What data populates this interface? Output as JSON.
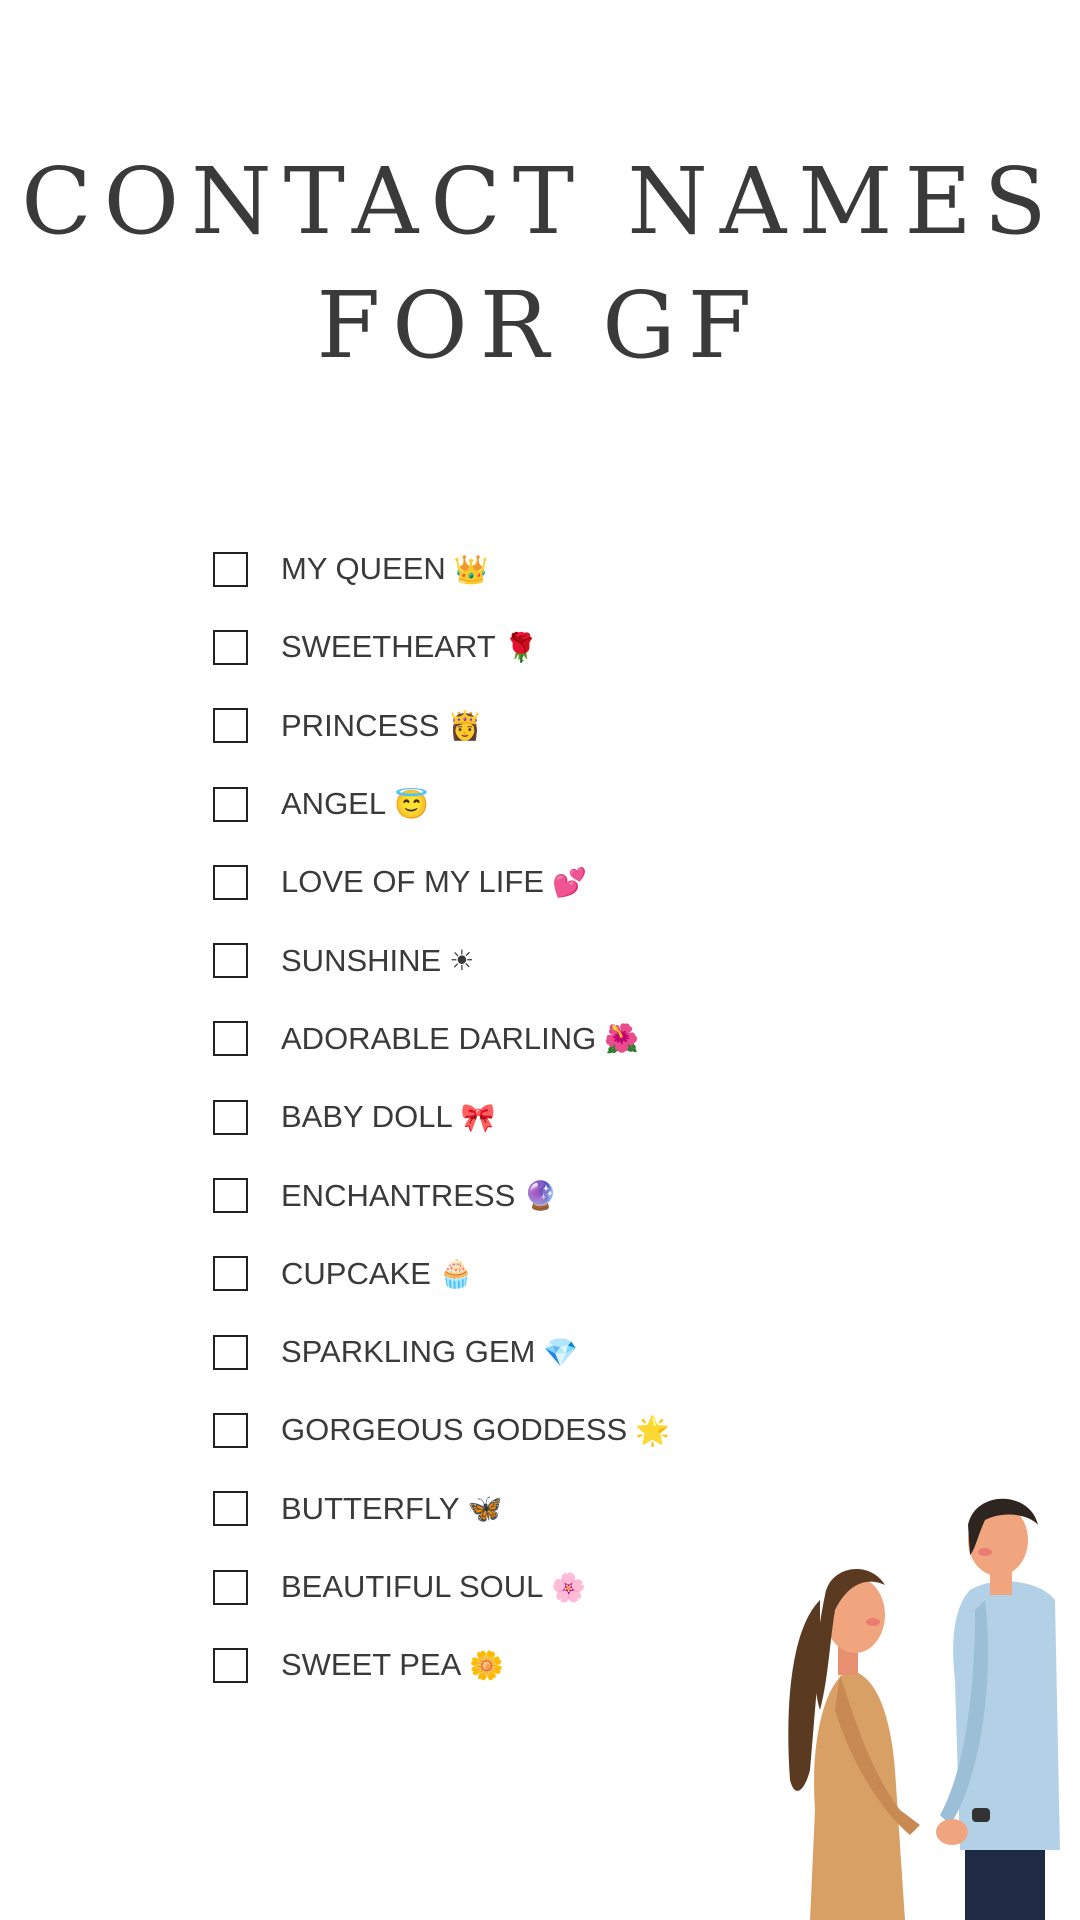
{
  "title": {
    "line1": "CONTACT NAMES",
    "line2": "FOR GF"
  },
  "items": [
    {
      "label": "MY QUEEN",
      "emoji": "👑",
      "checked": false
    },
    {
      "label": "SWEETHEART",
      "emoji": "🌹",
      "checked": false
    },
    {
      "label": "PRINCESS",
      "emoji": "👸",
      "checked": false
    },
    {
      "label": "ANGEL",
      "emoji": "😇",
      "checked": false
    },
    {
      "label": "LOVE OF MY LIFE",
      "emoji": "💕",
      "checked": false
    },
    {
      "label": "SUNSHINE",
      "emoji": "☀",
      "checked": false
    },
    {
      "label": "ADORABLE DARLING",
      "emoji": "🌺",
      "checked": false
    },
    {
      "label": "BABY DOLL",
      "emoji": "🎀",
      "checked": false
    },
    {
      "label": "ENCHANTRESS",
      "emoji": "🔮",
      "checked": false
    },
    {
      "label": "CUPCAKE",
      "emoji": "🧁",
      "checked": false
    },
    {
      "label": "SPARKLING GEM",
      "emoji": "💎",
      "checked": false
    },
    {
      "label": "GORGEOUS GODDESS",
      "emoji": "🌟",
      "checked": false
    },
    {
      "label": "BUTTERFLY",
      "emoji": "🦋",
      "checked": false
    },
    {
      "label": "BEAUTIFUL SOUL",
      "emoji": "🌸",
      "checked": false
    },
    {
      "label": "SWEET PEA",
      "emoji": "🌼",
      "checked": false
    }
  ],
  "colors": {
    "text": "#3a3a3a",
    "checkbox_border": "#222222",
    "background": "#ffffff"
  }
}
